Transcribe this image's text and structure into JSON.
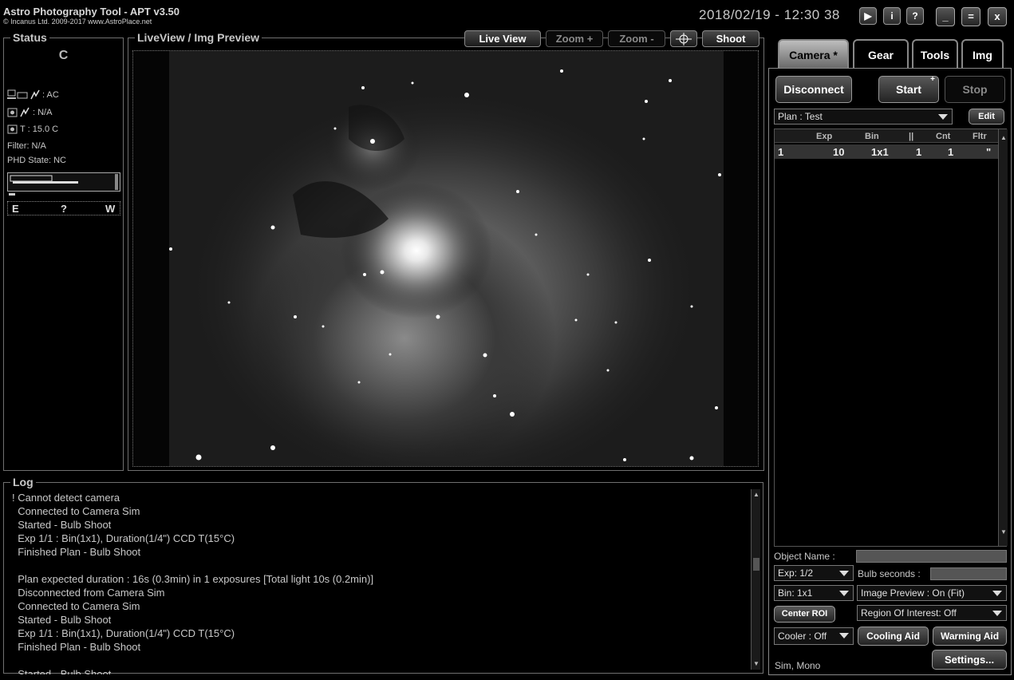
{
  "app": {
    "title": "Astro Photography Tool  -  APT v3.50",
    "copyright": "© Incanus Ltd. 2009-2017  www.AstroPlace.net",
    "datetime": "2018/02/19 - 12:30 38",
    "title_buttons": [
      "▶",
      "i",
      "?"
    ],
    "window_buttons": [
      "_",
      "=",
      "x"
    ]
  },
  "status": {
    "title": "Status",
    "letter": "C",
    "power": ": AC",
    "camera_power": ": N/A",
    "temp_label": "T :",
    "temp_value": "15.0 C",
    "filter": "Filter: N/A",
    "phd_state": "PHD State: NC",
    "guide_e": "E",
    "guide_q": "?",
    "guide_w": "W"
  },
  "liveview": {
    "title": "LiveView / Img Preview",
    "live_view": "Live View",
    "zoom_plus": "Zoom +",
    "zoom_minus": "Zoom -",
    "shoot": "Shoot"
  },
  "log": {
    "title": "Log",
    "lines": [
      "! Cannot detect camera",
      "  Connected to Camera Sim",
      "  Started - Bulb Shoot",
      "  Exp 1/1 : Bin(1x1), Duration(1/4\") CCD T(15°C)",
      "  Finished Plan - Bulb Shoot",
      "",
      "  Plan expected duration : 16s (0.3min) in 1 exposures [Total light 10s (0.2min)]",
      "  Disconnected from Camera Sim",
      "  Connected to Camera Sim",
      "  Started - Bulb Shoot",
      "  Exp 1/1 : Bin(1x1), Duration(1/4\") CCD T(15°C)",
      "  Finished Plan - Bulb Shoot",
      "",
      "  Started - Bulb Shoot"
    ]
  },
  "tabs": [
    "Camera *",
    "Gear",
    "Tools",
    "Img"
  ],
  "camera": {
    "disconnect": "Disconnect",
    "start": "Start",
    "start_plus": "+",
    "stop": "Stop",
    "plan": "Plan : Test",
    "edit": "Edit",
    "plan_columns": [
      "Exp",
      "Bin",
      "||",
      "Cnt",
      "Fltr"
    ],
    "plan_row": {
      "num": "1",
      "exp": "10",
      "bin": "1x1",
      "pause": "1",
      "cnt": "1",
      "fltr": "\""
    },
    "object_name_label": "Object Name :",
    "exp": "Exp: 1/2",
    "bulb_seconds_label": "Bulb seconds :",
    "bin": "Bin: 1x1",
    "image_preview": "Image Preview : On (Fit)",
    "center_roi": "Center ROI",
    "roi": "Region Of Interest: Off",
    "cooler": "Cooler : Off",
    "cooling_aid": "Cooling Aid",
    "warming_aid": "Warming Aid",
    "camera_info": "Sim, Mono",
    "settings": "Settings..."
  }
}
